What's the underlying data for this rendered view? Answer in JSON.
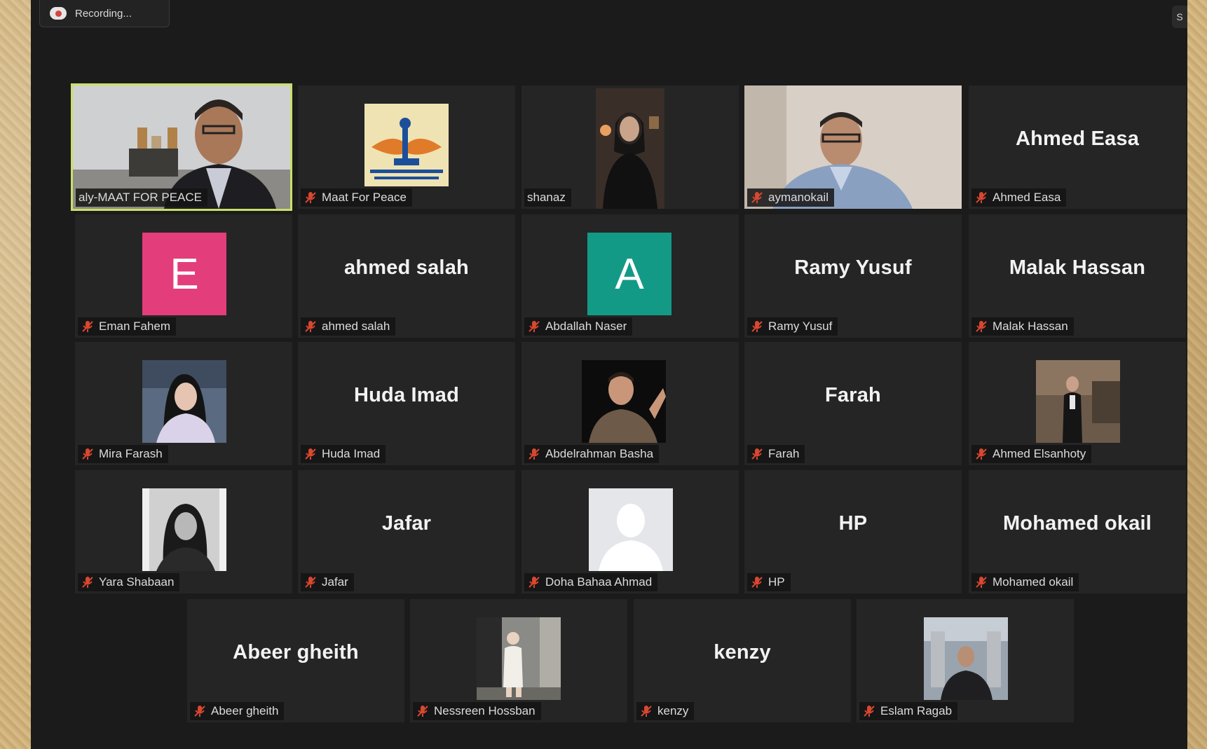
{
  "recording": {
    "label": "Recording..."
  },
  "corner_label": "S",
  "colors": {
    "active_speaker_border": "#c8e06a",
    "muted_mic": "#d9472f",
    "tile_background": "#252525",
    "avatar_pink": "#e43d7b",
    "avatar_teal": "#139a87"
  },
  "participants": [
    {
      "name": "aly-MAAT FOR PEACE",
      "video": "camera",
      "active_speaker": true,
      "muted": false
    },
    {
      "name": "Maat For Peace",
      "video": "logo",
      "muted": true
    },
    {
      "name": "shanaz",
      "video": "camera",
      "muted": false
    },
    {
      "name": "aymanokail",
      "video": "camera",
      "muted": true
    },
    {
      "name": "Ahmed Easa",
      "display_name": "Ahmed Easa",
      "video": "off",
      "muted": true
    },
    {
      "name": "Eman Fahem",
      "video": "avatar",
      "avatar_letter": "E",
      "muted": true
    },
    {
      "name": "ahmed salah",
      "display_name": "ahmed salah",
      "video": "off",
      "muted": true
    },
    {
      "name": "Abdallah Naser",
      "video": "avatar",
      "avatar_letter": "A",
      "muted": true
    },
    {
      "name": "Ramy Yusuf",
      "display_name": "Ramy Yusuf",
      "video": "off",
      "muted": true
    },
    {
      "name": "Malak Hassan",
      "display_name": "Malak Hassan",
      "video": "off",
      "muted": true
    },
    {
      "name": "Mira Farash",
      "video": "profile-photo",
      "muted": true
    },
    {
      "name": "Huda Imad",
      "display_name": "Huda Imad",
      "video": "off",
      "muted": true
    },
    {
      "name": "Abdelrahman Basha",
      "video": "profile-photo",
      "muted": true
    },
    {
      "name": "Farah",
      "display_name": "Farah",
      "video": "off",
      "muted": true
    },
    {
      "name": "Ahmed Elsanhoty",
      "video": "profile-photo",
      "muted": true
    },
    {
      "name": "Yara Shabaan",
      "video": "profile-photo",
      "muted": true
    },
    {
      "name": "Jafar",
      "display_name": "Jafar",
      "video": "off",
      "muted": true
    },
    {
      "name": "Doha Bahaa Ahmad",
      "video": "default-avatar",
      "muted": true
    },
    {
      "name": "HP",
      "display_name": "HP",
      "video": "off",
      "muted": true
    },
    {
      "name": "Mohamed okail",
      "display_name": "Mohamed okail",
      "video": "off",
      "muted": true
    },
    {
      "name": "Abeer gheith",
      "display_name": "Abeer gheith",
      "video": "off",
      "muted": true
    },
    {
      "name": "Nessreen Hossban",
      "video": "profile-photo",
      "muted": true
    },
    {
      "name": "kenzy",
      "display_name": "kenzy",
      "video": "off",
      "muted": true
    },
    {
      "name": "Eslam Ragab",
      "video": "profile-photo",
      "muted": true
    }
  ]
}
